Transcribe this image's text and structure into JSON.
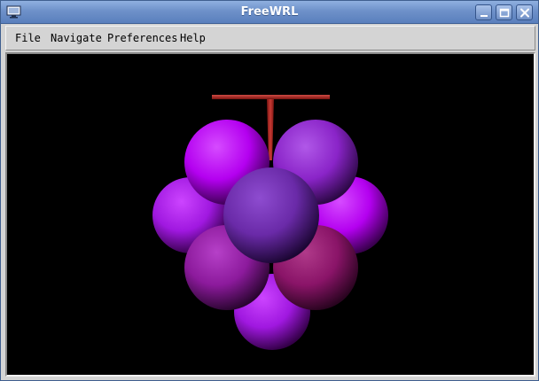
{
  "window": {
    "title": "FreeWRL"
  },
  "menu": {
    "items": [
      {
        "label": "File"
      },
      {
        "label": "Navigate"
      },
      {
        "label": "Preferences"
      },
      {
        "label": "Help"
      }
    ]
  },
  "icons": {
    "app": "monitor-icon",
    "minimize": "minimize-icon",
    "maximize": "maximize-icon",
    "close": "close-icon"
  },
  "scene": {
    "background": "#000000",
    "stem_color": "#a52a2a",
    "grape_colors": [
      "#b400ff",
      "#9a2bd6",
      "#8a1ec0",
      "#a020c8",
      "#6c2a9a",
      "#8a1070"
    ]
  }
}
